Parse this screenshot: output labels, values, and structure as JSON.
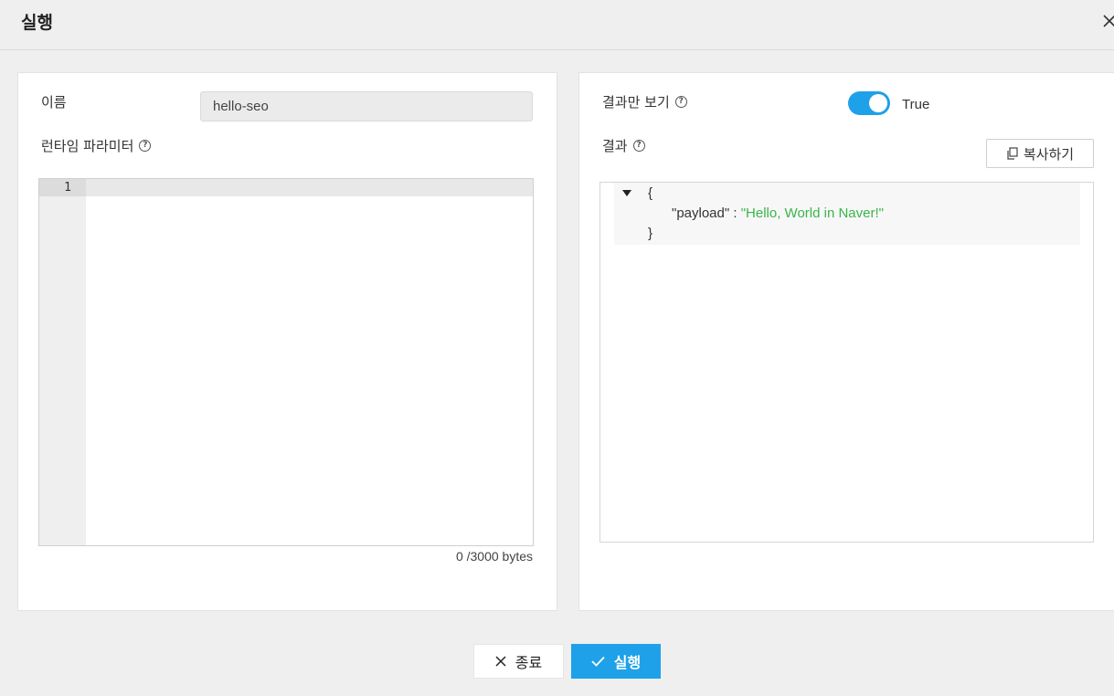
{
  "dialog": {
    "title": "실행",
    "close_icon": "close-icon"
  },
  "left_panel": {
    "name_label": "이름",
    "name_value": "hello-seo",
    "params_label": "런타임 파라미터",
    "help_glyph": "?",
    "editor": {
      "line_numbers": [
        "1"
      ],
      "content": ""
    },
    "byte_counter": "0 /3000 bytes"
  },
  "right_panel": {
    "result_only_label": "결과만 보기",
    "toggle_state": "True",
    "toggle_on": true,
    "toggle_color": "#1ea1e8",
    "result_label": "결과",
    "copy_button": "복사하기",
    "copy_icon": "copy-icon",
    "json": {
      "open_brace": "{",
      "key": "\"payload\"",
      "separator": " : ",
      "value": "\"Hello, World in Naver!\"",
      "close_brace": "}",
      "value_color": "#3ab54a"
    }
  },
  "footer": {
    "close_button": "종료",
    "run_button": "실행",
    "run_color": "#1ea1e8"
  }
}
